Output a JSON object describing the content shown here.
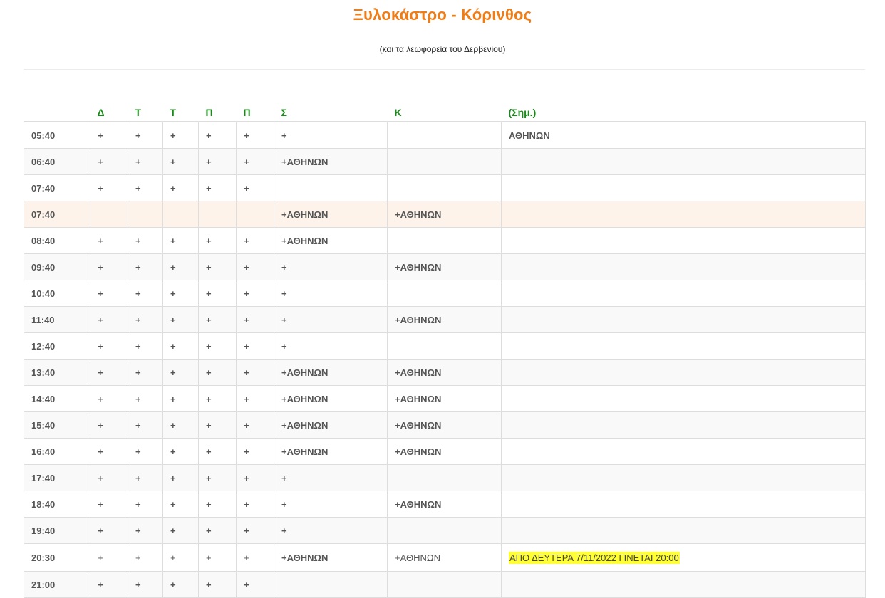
{
  "page": {
    "title": "Ξυλοκάστρο - Κόρινθος",
    "subtitle": "(και τα λεωφορεία του Δερβενίου)"
  },
  "table": {
    "headers": [
      "",
      "Δ",
      "Τ",
      "Τ",
      "Π",
      "Π",
      "Σ",
      "Κ",
      "(Σημ.)"
    ],
    "rows": [
      {
        "time": "05:40",
        "d": "+",
        "t1": "+",
        "t2": "+",
        "p1": "+",
        "p2": "+",
        "s": "+",
        "k": "",
        "note": "ΑΘΗΝΩΝ"
      },
      {
        "time": "06:40",
        "d": "+",
        "t1": "+",
        "t2": "+",
        "p1": "+",
        "p2": "+",
        "s": " +ΑΘΗΝΩΝ",
        "k": "",
        "note": ""
      },
      {
        "time": "07:40",
        "d": "+",
        "t1": "+",
        "t2": "+",
        "p1": "+",
        "p2": "+",
        "s": "",
        "k": "",
        "note": ""
      },
      {
        "time": "07:40",
        "d": "",
        "t1": "",
        "t2": "",
        "p1": "",
        "p2": "",
        "s": "+ΑΘΗΝΩΝ",
        "k": "+ΑΘΗΝΩΝ",
        "note": ""
      },
      {
        "time": "08:40",
        "d": "+",
        "t1": "+",
        "t2": "+",
        "p1": "+",
        "p2": "+",
        "s": "+ΑΘΗΝΩΝ",
        "k": "",
        "note": ""
      },
      {
        "time": "09:40",
        "d": "+",
        "t1": "+",
        "t2": "+",
        "p1": "+",
        "p2": "+",
        "s": "+",
        "k": "+ΑΘΗΝΩΝ",
        "note": ""
      },
      {
        "time": "10:40",
        "d": "+",
        "t1": "+",
        "t2": "+",
        "p1": "+",
        "p2": "+",
        "s": " +",
        "k": "",
        "note": ""
      },
      {
        "time": "11:40",
        "d": "+",
        "t1": "+",
        "t2": "+",
        "p1": "+",
        "p2": "+",
        "s": "+",
        "k": "+ΑΘΗΝΩΝ",
        "note": ""
      },
      {
        "time": "12:40",
        "d": "+",
        "t1": "+",
        "t2": "+",
        "p1": "+",
        "p2": "+",
        "s": "+",
        "k": "",
        "note": ""
      },
      {
        "time": "13:40",
        "d": "+",
        "t1": "+",
        "t2": "+",
        "p1": "+",
        "p2": "+",
        "s": "+ΑΘΗΝΩΝ",
        "k": "+ΑΘΗΝΩΝ",
        "note": ""
      },
      {
        "time": "14:40",
        "d": "+",
        "t1": "+",
        "t2": "+",
        "p1": "+",
        "p2": "+",
        "s": "+ΑΘΗΝΩΝ",
        "k": " +ΑΘΗΝΩΝ",
        "note": ""
      },
      {
        "time": "15:40",
        "d": "+",
        "t1": "+",
        "t2": "+",
        "p1": "+",
        "p2": "+",
        "s": "+ΑΘΗΝΩΝ",
        "k": "+ΑΘΗΝΩΝ",
        "note": ""
      },
      {
        "time": "16:40",
        "d": "+",
        "t1": "+",
        "t2": "+",
        "p1": "+",
        "p2": "+",
        "s": "+ΑΘΗΝΩΝ",
        "k": "+ΑΘΗΝΩΝ",
        "note": ""
      },
      {
        "time": "17:40",
        "d": "+",
        "t1": "+",
        "t2": "+",
        "p1": "+",
        "p2": "+",
        "s": "+",
        "k": "",
        "note": ""
      },
      {
        "time": "18:40",
        "d": "+",
        "t1": "+",
        "t2": "+",
        "p1": "+",
        "p2": "+",
        "s": "+",
        "k": "+ΑΘΗΝΩΝ",
        "note": ""
      },
      {
        "time": "19:40",
        "d": "+",
        "t1": "+",
        "t2": "+",
        "p1": "+",
        "p2": "+",
        "s": " +",
        "k": "",
        "note": ""
      },
      {
        "time": "20:30",
        "d": "+",
        "t1": "+",
        "t2": "+",
        "p1": "+",
        "p2": "+",
        "s": "+ΑΘΗΝΩΝ",
        "k": " +ΑΘΗΝΩΝ",
        "note": "ΑΠΟ ΔΕΥΤΕΡΑ 7/11/2022 ΓΙΝΕΤΑΙ 20:00"
      },
      {
        "time": "21:00",
        "d": "+",
        "t1": "+",
        "t2": "+",
        "p1": "+",
        "p2": "+",
        "s": "",
        "k": "",
        "note": ""
      }
    ]
  },
  "colors": {
    "title": "#f07c16",
    "header_text": "#1a8a1a",
    "weekend_row": "#fdf3ea",
    "note_highlight": "#ffff33"
  }
}
